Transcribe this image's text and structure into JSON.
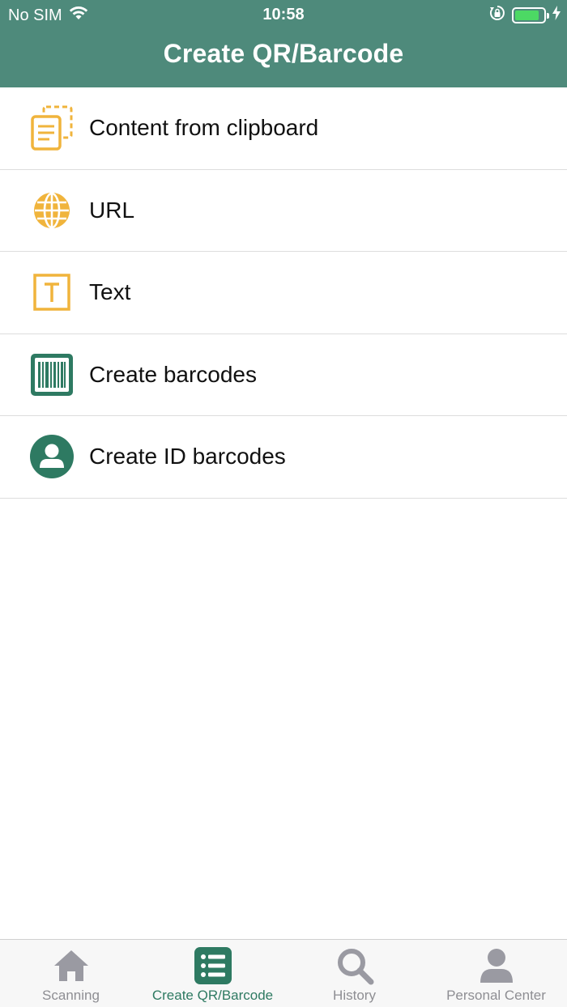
{
  "status_bar": {
    "carrier": "No SIM",
    "time": "10:58",
    "battery_level": 0.85,
    "icons": [
      "wifi-icon",
      "rotation-lock-icon",
      "battery-icon",
      "charging-icon"
    ]
  },
  "header": {
    "title": "Create QR/Barcode",
    "background": "#4e8a7b"
  },
  "menu": {
    "items": [
      {
        "label": "Content from clipboard",
        "icon": "clipboard-icon",
        "icon_color": "#f0b43c"
      },
      {
        "label": "URL",
        "icon": "globe-icon",
        "icon_color": "#f0b43c"
      },
      {
        "label": "Text",
        "icon": "text-icon",
        "icon_color": "#f0b43c"
      },
      {
        "label": "Create barcodes",
        "icon": "barcode-icon",
        "icon_color": "#2e7a62"
      },
      {
        "label": "Create ID barcodes",
        "icon": "person-icon",
        "icon_color": "#2e7a62"
      }
    ]
  },
  "tabbar": {
    "active_color": "#2e7a62",
    "inactive_color": "#8e8e93",
    "tabs": [
      {
        "label": "Scanning",
        "icon": "home-icon",
        "active": false
      },
      {
        "label": "Create QR/Barcode",
        "icon": "list-icon",
        "active": true
      },
      {
        "label": "History",
        "icon": "search-icon",
        "active": false
      },
      {
        "label": "Personal Center",
        "icon": "person-icon",
        "active": false
      }
    ]
  }
}
